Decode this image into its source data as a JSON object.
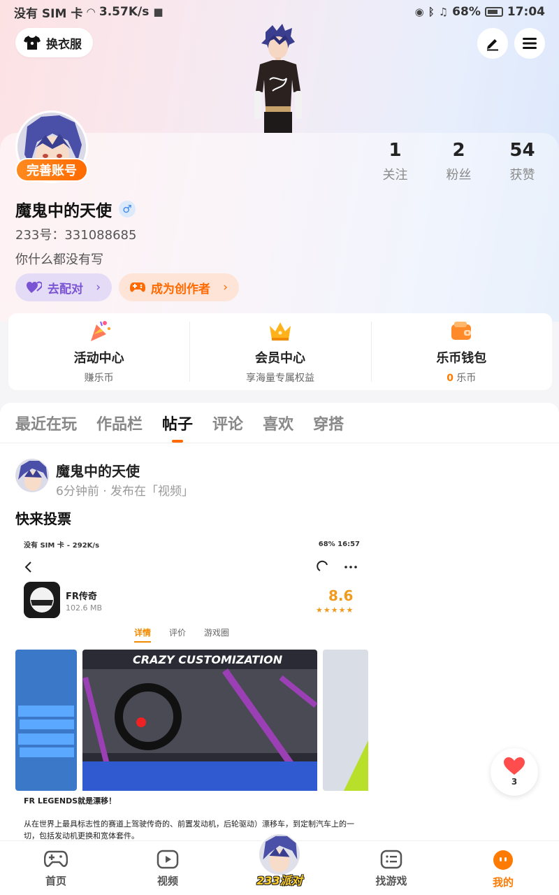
{
  "status_bar": {
    "carrier": "没有 SIM 卡",
    "speed": "3.57K/s",
    "battery": "68%",
    "time": "17:04"
  },
  "header": {
    "wardrobe_label": "换衣服",
    "edit_icon": "pen-icon",
    "menu_icon": "hamburger-icon"
  },
  "profile": {
    "badge": "完善账号",
    "stats": [
      {
        "num": "1",
        "label": "关注"
      },
      {
        "num": "2",
        "label": "粉丝"
      },
      {
        "num": "54",
        "label": "获赞"
      }
    ],
    "username": "魔鬼中的天使",
    "gender_symbol": "♂",
    "uid": "233号：331088685",
    "bio": "你什么都没有写",
    "match_label": "去配对",
    "creator_label": "成为创作者"
  },
  "features": [
    {
      "title": "活动中心",
      "sub": "赚乐币",
      "icon": "party-popper-icon"
    },
    {
      "title": "会员中心",
      "sub": "享海量专属权益",
      "icon": "crown-icon"
    },
    {
      "title": "乐币钱包",
      "sub_num": "0",
      "sub_unit": "乐币",
      "icon": "wallet-icon"
    }
  ],
  "tabs": [
    "最近在玩",
    "作品栏",
    "帖子",
    "评论",
    "喜欢",
    "穿搭"
  ],
  "active_tab": "帖子",
  "post": {
    "author": "魔鬼中的天使",
    "meta": "6分钟前 · 发布在「视频」",
    "title": "快来投票",
    "shot": {
      "status_left": "没有 SIM 卡 ⁃ 292K/s",
      "status_right": "68%  16:57",
      "app_name": "FR传奇",
      "app_size": "102.6 MB",
      "score": "8.6",
      "stars": "★★★★★",
      "tabs": [
        "详情",
        "评价",
        "游戏圈"
      ],
      "banner": "CRAZY CUSTOMIZATION",
      "desc1": "FR LEGENDS就是漂移！",
      "desc2": "从在世界上最具标志性的赛道上驾驶传奇的、前置发动机，后轮驱动）漂移车，到定制汽车上的一切，包括发动机更换和宽体套件。"
    },
    "like_count": "3"
  },
  "bottom_nav": [
    {
      "label": "首页",
      "icon": "gamepad-icon"
    },
    {
      "label": "视频",
      "icon": "play-icon"
    },
    {
      "label": "233派对",
      "icon": "avatar-icon"
    },
    {
      "label": "找游戏",
      "icon": "list-icon"
    },
    {
      "label": "我的",
      "icon": "face-icon"
    }
  ],
  "colors": {
    "accent": "#ff6a00",
    "purple": "#7a54d2"
  }
}
